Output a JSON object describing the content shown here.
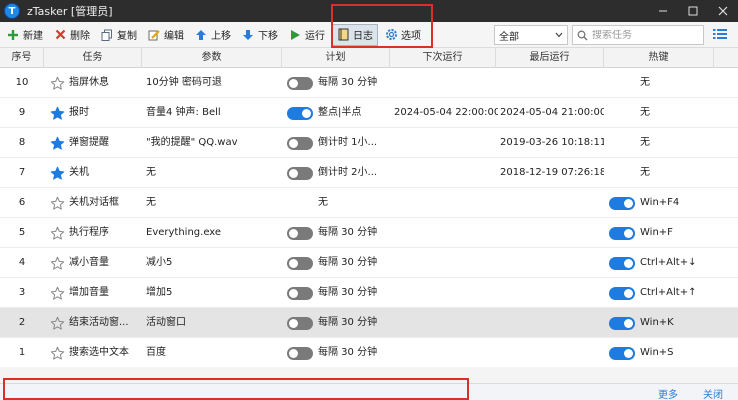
{
  "window": {
    "app_logo_letter": "T",
    "title": "zTasker [管理员]"
  },
  "toolbar": {
    "new_label": "新建",
    "delete_label": "删除",
    "copy_label": "复制",
    "edit_label": "编辑",
    "move_up_label": "上移",
    "move_down_label": "下移",
    "run_label": "运行",
    "log_label": "日志",
    "options_label": "选项",
    "filter_value": "全部",
    "search_placeholder": "搜索任务"
  },
  "columns": [
    "序号",
    "任务",
    "参数",
    "计划",
    "下次运行",
    "最后运行",
    "热键"
  ],
  "rows": [
    {
      "id": "10",
      "starred": false,
      "task": "指屏休息",
      "param": "10分钟 密码可退",
      "toggle": "off",
      "plan": "每隔 30 分钟",
      "next": "",
      "last": "",
      "hotkey_toggle": "none",
      "hotkey": "无",
      "selected": false
    },
    {
      "id": "9",
      "starred": true,
      "task": "报时",
      "param": "音量4 钟声: Bell",
      "toggle": "on",
      "plan": "整点|半点",
      "next": "2024-05-04 22:00:00",
      "last": "2024-05-04 21:00:00",
      "hotkey_toggle": "none",
      "hotkey": "无",
      "selected": false
    },
    {
      "id": "8",
      "starred": true,
      "task": "弹窗提醒",
      "param": "\"我的提醒\" QQ.wav",
      "toggle": "off",
      "plan": "倒计时 1小...",
      "next": "",
      "last": "2019-03-26 10:18:11",
      "hotkey_toggle": "none",
      "hotkey": "无",
      "selected": false
    },
    {
      "id": "7",
      "starred": true,
      "task": "关机",
      "param": "无",
      "toggle": "off",
      "plan": "倒计时 2小...",
      "next": "",
      "last": "2018-12-19 07:26:18",
      "hotkey_toggle": "none",
      "hotkey": "无",
      "selected": false
    },
    {
      "id": "6",
      "starred": false,
      "task": "关机对话框",
      "param": "无",
      "toggle": "none",
      "plan": "无",
      "next": "",
      "last": "",
      "hotkey_toggle": "on",
      "hotkey": "Win+F4",
      "selected": false
    },
    {
      "id": "5",
      "starred": false,
      "task": "执行程序",
      "param": "Everything.exe",
      "toggle": "off",
      "plan": "每隔 30 分钟",
      "next": "",
      "last": "",
      "hotkey_toggle": "on",
      "hotkey": "Win+F",
      "selected": false
    },
    {
      "id": "4",
      "starred": false,
      "task": "减小音量",
      "param": "减小5",
      "toggle": "off",
      "plan": "每隔 30 分钟",
      "next": "",
      "last": "",
      "hotkey_toggle": "on",
      "hotkey": "Ctrl+Alt+↓",
      "selected": false
    },
    {
      "id": "3",
      "starred": false,
      "task": "增加音量",
      "param": "增加5",
      "toggle": "off",
      "plan": "每隔 30 分钟",
      "next": "",
      "last": "",
      "hotkey_toggle": "on",
      "hotkey": "Ctrl+Alt+↑",
      "selected": false
    },
    {
      "id": "2",
      "starred": false,
      "task": "结束活动窗...",
      "param": "活动窗口",
      "toggle": "off",
      "plan": "每隔 30 分钟",
      "next": "",
      "last": "",
      "hotkey_toggle": "on",
      "hotkey": "Win+K",
      "selected": true
    },
    {
      "id": "1",
      "starred": false,
      "task": "搜索选中文本",
      "param": "百度",
      "toggle": "off",
      "plan": "每隔 30 分钟",
      "next": "",
      "last": "",
      "hotkey_toggle": "on",
      "hotkey": "Win+S",
      "selected": false
    }
  ],
  "footer": {
    "more_label": "更多",
    "close_label": "关闭"
  },
  "colors": {
    "title_bar": "#2d2d2d",
    "toggle_on": "#1e7be0",
    "toggle_off": "#7a7a7a",
    "star_filled": "#1e7be0",
    "highlight_box": "#d9302a",
    "link": "#2a7dd6"
  },
  "icons": {
    "new": "plus-icon",
    "delete": "x-icon",
    "copy": "copy-icon",
    "edit": "pencil-icon",
    "move_up": "arrow-up-icon",
    "move_down": "arrow-down-icon",
    "run": "play-icon",
    "log": "notebook-icon",
    "options": "gear-icon",
    "search": "search-icon",
    "menu": "list-icon"
  }
}
